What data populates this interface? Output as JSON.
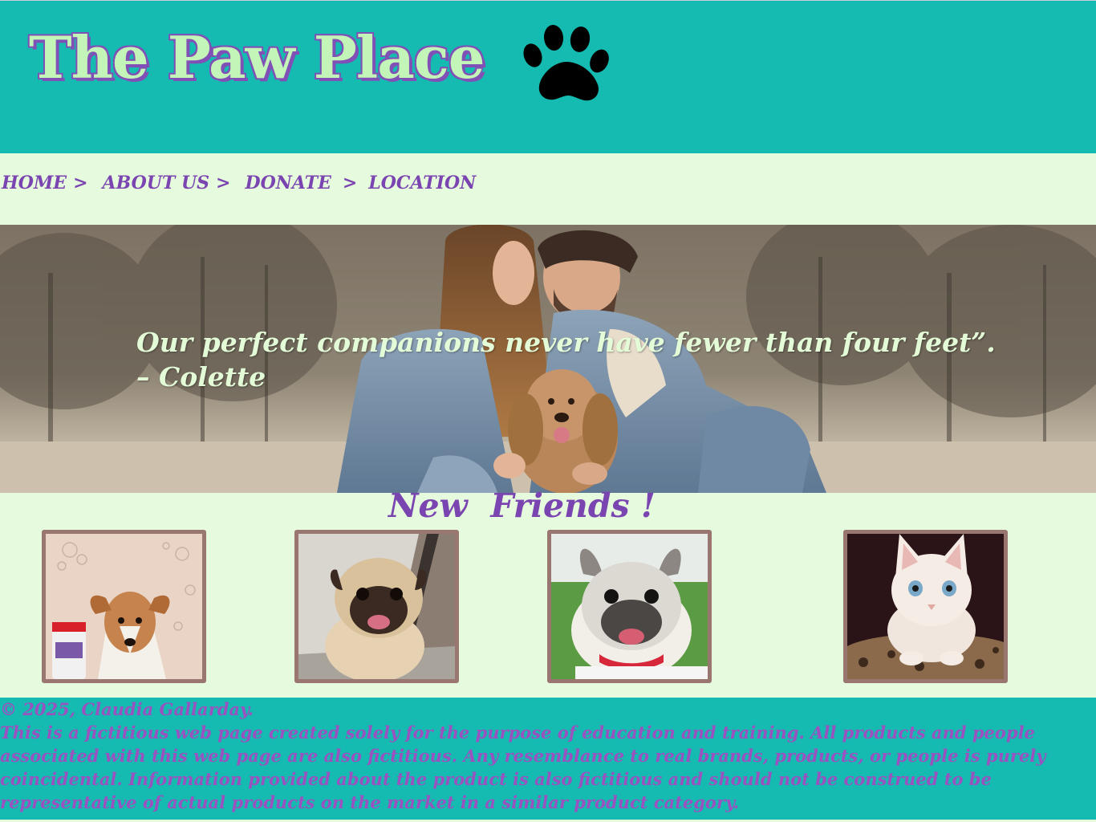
{
  "header": {
    "title": "The Paw Place",
    "logo_icon": "paw-print-icon"
  },
  "nav": {
    "items": [
      {
        "label": "HOME"
      },
      {
        "label": "ABOUT US"
      },
      {
        "label": "DONATE"
      },
      {
        "label": "LOCATION"
      }
    ],
    "separator": ">"
  },
  "hero": {
    "quote_line1": "Our perfect companions never have fewer than four feet”.",
    "quote_line2": "– Colette"
  },
  "friends": {
    "title": "New  Friends !",
    "pets": [
      {
        "name": "jack-russell-dog"
      },
      {
        "name": "pug-dog"
      },
      {
        "name": "french-bulldog"
      },
      {
        "name": "white-kitten"
      }
    ]
  },
  "footer": {
    "copyright": "© 2025, Claudia Gallarday.",
    "disclaimer_lines": [
      "This is a fictitious web page created solely for the purpose of education and training. All products and people",
      "associated with this web page are also fictitious. Any resemblance to real brands, products, or people is purely",
      "coincidental. Information provided about the product is also fictitious and should not be construed to be",
      "representative of actual products on the market in a similar product category."
    ]
  },
  "colors": {
    "teal": "#15bbb0",
    "mint": "#e6fadd",
    "purple": "#7a45b0",
    "title_fill": "#c4f5b8",
    "card_border": "#9a7670"
  }
}
